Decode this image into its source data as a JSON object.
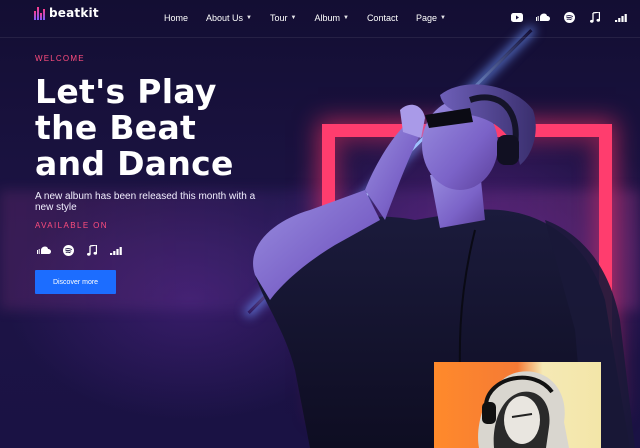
{
  "brand": {
    "name": "beatkit"
  },
  "nav": {
    "items": [
      {
        "label": "Home",
        "has_dropdown": false
      },
      {
        "label": "About Us",
        "has_dropdown": true
      },
      {
        "label": "Tour",
        "has_dropdown": true
      },
      {
        "label": "Album",
        "has_dropdown": true
      },
      {
        "label": "Contact",
        "has_dropdown": false
      },
      {
        "label": "Page",
        "has_dropdown": true
      }
    ],
    "social_icons": [
      "youtube-icon",
      "soundcloud-icon",
      "spotify-icon",
      "music-note-icon",
      "deezer-icon"
    ]
  },
  "hero": {
    "eyebrow": "WELCOME",
    "headline_lines": [
      "Let's Play",
      "the Beat",
      "and Dance"
    ],
    "subtext": "A new album has been released this month with a new style",
    "available_label": "AVAILABLE ON",
    "available_icons": [
      "soundcloud-icon",
      "spotify-icon",
      "music-note-icon",
      "deezer-icon"
    ],
    "cta_label": "Discover more"
  },
  "colors": {
    "accent_pink": "#ff4d7e",
    "button_blue": "#1c6dff",
    "neon_frame": "#ff3d6e",
    "background": "#140f33"
  }
}
